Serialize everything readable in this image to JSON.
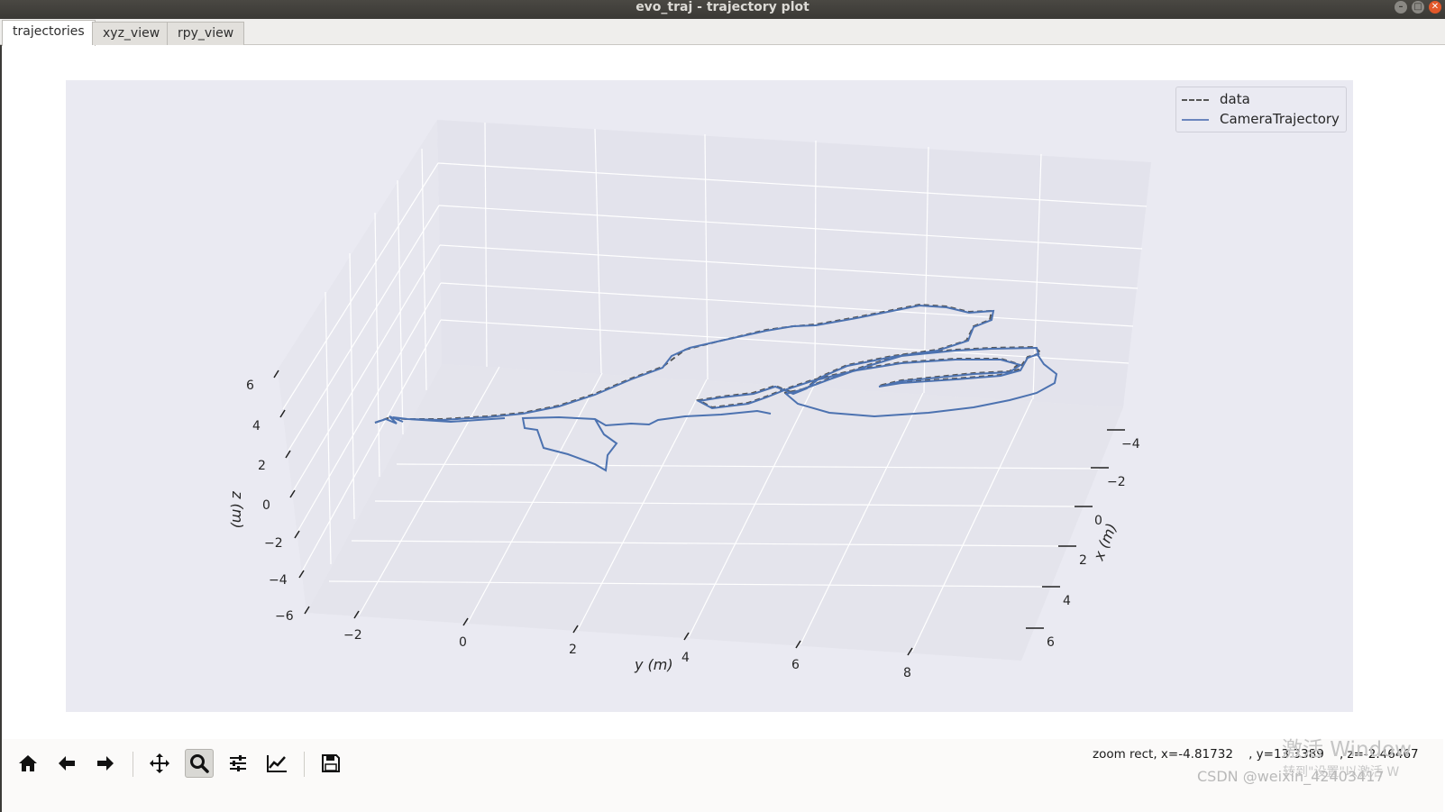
{
  "window": {
    "title": "evo_traj - trajectory plot",
    "buttons": [
      "minimize",
      "maximize",
      "close"
    ]
  },
  "tabs": [
    {
      "label": "trajectories",
      "active": true
    },
    {
      "label": "xyz_view",
      "active": false
    },
    {
      "label": "rpy_view",
      "active": false
    }
  ],
  "chart_data": {
    "type": "line",
    "projection": "3d",
    "xlabel": "x (m)",
    "ylabel": "y (m)",
    "zlabel": "z (m)",
    "x_ticks": [
      "−4",
      "−2",
      "0",
      "2",
      "4",
      "6"
    ],
    "y_ticks": [
      "−2",
      "0",
      "2",
      "4",
      "6",
      "8"
    ],
    "z_ticks": [
      "6",
      "4",
      "2",
      "0",
      "−2",
      "−4",
      "−6"
    ],
    "xlim": [
      -5,
      7
    ],
    "ylim": [
      -3,
      9
    ],
    "zlim": [
      -6,
      6
    ],
    "grid": true,
    "legend_position": "top-right",
    "series": [
      {
        "name": "data",
        "style": "dashed",
        "color": "#555555"
      },
      {
        "name": "CameraTrajectory",
        "style": "solid",
        "color": "#4c72b0"
      }
    ]
  },
  "toolbar": {
    "buttons": [
      {
        "icon": "home-icon",
        "tooltip": "Reset original view"
      },
      {
        "icon": "arrow-left-icon",
        "tooltip": "Back"
      },
      {
        "icon": "arrow-right-icon",
        "tooltip": "Forward"
      },
      {
        "icon": "move-icon",
        "tooltip": "Pan"
      },
      {
        "icon": "zoom-icon",
        "tooltip": "Zoom",
        "active": true
      },
      {
        "icon": "sliders-icon",
        "tooltip": "Configure subplots"
      },
      {
        "icon": "chart-line-icon",
        "tooltip": "Edit axis"
      },
      {
        "icon": "save-icon",
        "tooltip": "Save"
      }
    ],
    "status": "zoom rect, x=-4.81732    , y=13.3389    , z=-2.46467"
  },
  "overlay": {
    "watermark_line1": "激活 Window",
    "watermark_line2": "转到\"设置\"以激活 W",
    "csdn": "CSDN @weixin_42403417"
  }
}
